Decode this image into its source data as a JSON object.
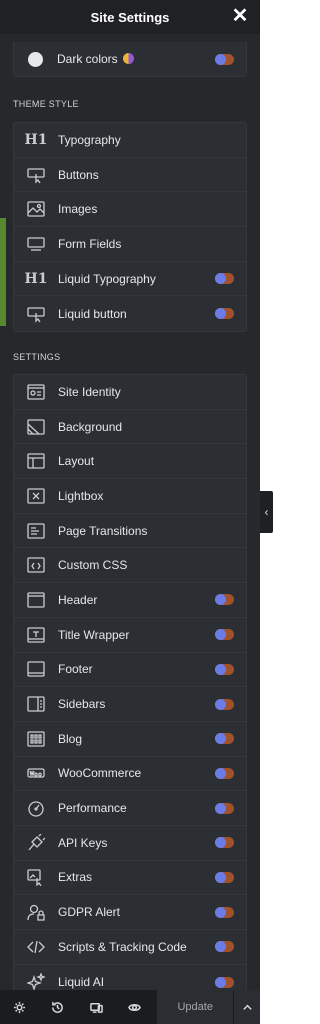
{
  "header": {
    "title": "Site Settings",
    "close_glyph": "✕"
  },
  "colors": {
    "toggle_on": "#6b7ce6",
    "toggle_off": "#a0522d",
    "panel_bg": "#26292c",
    "accent_green": "#58882f"
  },
  "dark_colors": {
    "label": "Dark colors",
    "toggle": true
  },
  "theme_style": {
    "title": "THEME STYLE",
    "items": [
      {
        "label": "Typography",
        "icon": "h1-icon",
        "toggle": false
      },
      {
        "label": "Buttons",
        "icon": "button-pointer-icon",
        "toggle": false
      },
      {
        "label": "Images",
        "icon": "image-icon",
        "toggle": false
      },
      {
        "label": "Form Fields",
        "icon": "form-field-icon",
        "toggle": false
      },
      {
        "label": "Liquid Typography",
        "icon": "h1-icon",
        "toggle": true
      },
      {
        "label": "Liquid button",
        "icon": "button-pointer-icon",
        "toggle": true
      }
    ]
  },
  "settings": {
    "title": "SETTINGS",
    "items": [
      {
        "label": "Site Identity",
        "icon": "site-identity-icon",
        "toggle": false
      },
      {
        "label": "Background",
        "icon": "background-icon",
        "toggle": false
      },
      {
        "label": "Layout",
        "icon": "layout-icon",
        "toggle": false
      },
      {
        "label": "Lightbox",
        "icon": "lightbox-icon",
        "toggle": false
      },
      {
        "label": "Page Transitions",
        "icon": "page-transitions-icon",
        "toggle": false
      },
      {
        "label": "Custom CSS",
        "icon": "code-window-icon",
        "toggle": false
      },
      {
        "label": "Header",
        "icon": "header-icon",
        "toggle": true
      },
      {
        "label": "Title Wrapper",
        "icon": "title-wrapper-icon",
        "toggle": true
      },
      {
        "label": "Footer",
        "icon": "footer-icon",
        "toggle": true
      },
      {
        "label": "Sidebars",
        "icon": "sidebar-icon",
        "toggle": true
      },
      {
        "label": "Blog",
        "icon": "blog-grid-icon",
        "toggle": true
      },
      {
        "label": "WooCommerce",
        "icon": "woocommerce-icon",
        "toggle": true
      },
      {
        "label": "Performance",
        "icon": "gauge-icon",
        "toggle": true
      },
      {
        "label": "API Keys",
        "icon": "plug-icon",
        "toggle": true
      },
      {
        "label": "Extras",
        "icon": "extras-icon",
        "toggle": true
      },
      {
        "label": "GDPR Alert",
        "icon": "user-lock-icon",
        "toggle": true
      },
      {
        "label": "Scripts & Tracking Code",
        "icon": "code-icon",
        "toggle": true
      },
      {
        "label": "Liquid AI",
        "icon": "sparkle-icon",
        "toggle": true
      }
    ]
  },
  "footer": {
    "buttons": [
      "settings-icon",
      "history-icon",
      "responsive-icon",
      "preview-icon"
    ],
    "update_label": "Update"
  }
}
